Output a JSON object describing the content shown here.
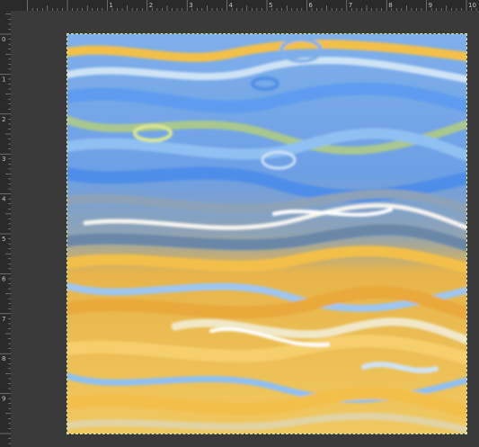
{
  "rulers": {
    "horizontal_labels": [
      "1",
      "2",
      "3",
      "4",
      "5",
      "6",
      "7",
      "8",
      "9",
      "10"
    ],
    "vertical_labels": [
      "0",
      "1",
      "2",
      "3",
      "4",
      "5",
      "6",
      "7",
      "8",
      "9"
    ]
  },
  "image": {
    "description_tags": [
      "marbled",
      "fluid",
      "swirl"
    ],
    "colors": {
      "sky_blue": "#5f9cef",
      "light_blue": "#8fc0f2",
      "steel": "#8da2b8",
      "sage": "#a9c78e",
      "cream": "#f0e8c8",
      "gold": "#f2c04a",
      "amber": "#e9a93a",
      "white": "#f6f4ee"
    }
  }
}
